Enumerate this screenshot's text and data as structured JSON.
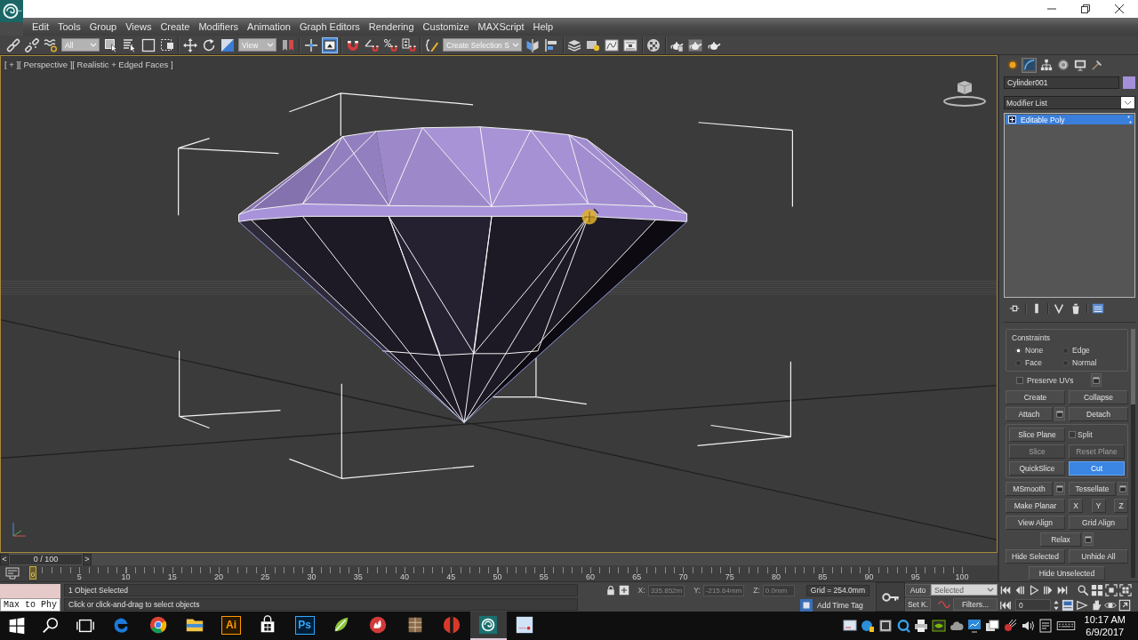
{
  "menu": [
    "Edit",
    "Tools",
    "Group",
    "Views",
    "Create",
    "Modifiers",
    "Animation",
    "Graph Editors",
    "Rendering",
    "Customize",
    "MAXScript",
    "Help"
  ],
  "toolbar": {
    "groups": [
      [
        {
          "kind": "link",
          "active": false
        },
        {
          "kind": "unlink",
          "active": false
        },
        {
          "kind": "bind",
          "active": false
        },
        {
          "kind": "dropdown",
          "value": "All",
          "active": false
        },
        {
          "kind": "select",
          "active": false
        },
        {
          "kind": "select-by-name",
          "active": false
        },
        {
          "kind": "region",
          "active": false
        },
        {
          "kind": "window-crossing",
          "active": false
        }
      ],
      [
        {
          "kind": "move",
          "active": false
        },
        {
          "kind": "rotate",
          "active": false
        },
        {
          "kind": "scale",
          "active": false
        },
        {
          "kind": "dropdown",
          "value": "View",
          "active": false
        },
        {
          "kind": "pivot",
          "active": false
        }
      ],
      [
        {
          "kind": "manipulate",
          "active": false
        },
        {
          "kind": "override",
          "active": true
        }
      ],
      [
        {
          "kind": "snap",
          "active": false
        },
        {
          "kind": "angle-snap",
          "active": false
        },
        {
          "kind": "percent-snap",
          "active": false
        },
        {
          "kind": "spinner-snap",
          "active": false
        }
      ],
      [
        {
          "kind": "named-selection",
          "active": false
        },
        {
          "kind": "dropdown",
          "value": "Create Selection S",
          "active": false
        },
        {
          "kind": "mirror",
          "active": false
        },
        {
          "kind": "align",
          "active": false
        }
      ],
      [
        {
          "kind": "layers",
          "active": false
        },
        {
          "kind": "scene-explorer",
          "active": false
        },
        {
          "kind": "curve-editor",
          "active": false
        },
        {
          "kind": "schematic",
          "active": false
        }
      ],
      [
        {
          "kind": "material-editor",
          "active": false
        }
      ],
      [
        {
          "kind": "render-setup",
          "active": false
        },
        {
          "kind": "rendered-frame",
          "active": false
        },
        {
          "kind": "render",
          "active": false
        }
      ]
    ]
  },
  "viewport": {
    "labels": [
      "[ + ]",
      "[ Perspective ]",
      "[ Realistic + Edged Faces ]"
    ]
  },
  "time_slider": {
    "previous": "<",
    "position": "0 / 100",
    "next": ">",
    "level": 0
  },
  "track_bar": {
    "current_frame": "0",
    "labels": [
      "5",
      "10",
      "15",
      "20",
      "25",
      "30",
      "35",
      "40",
      "45",
      "50",
      "55",
      "60",
      "65",
      "70",
      "75",
      "80",
      "85",
      "90",
      "95",
      "100"
    ]
  },
  "command_panel": {
    "tabs": [
      {
        "kind": "create",
        "selected": false
      },
      {
        "kind": "modify",
        "selected": true
      },
      {
        "kind": "hierarchy",
        "selected": false
      },
      {
        "kind": "motion",
        "selected": false
      },
      {
        "kind": "display",
        "selected": false
      },
      {
        "kind": "utilities",
        "selected": false
      }
    ],
    "object_name": "Cylinder001",
    "modifier_list": "Modifier List",
    "stack": [
      {
        "label": "Editable Poly",
        "selected": true,
        "expanded": false
      }
    ],
    "constraints": {
      "title": "Constraints",
      "options": [
        {
          "label": "None",
          "selected": true
        },
        {
          "label": "Edge",
          "selected": false
        },
        {
          "label": "Face",
          "selected": false
        },
        {
          "label": "Normal",
          "selected": false
        }
      ]
    },
    "preserve_uvs": {
      "label": "Preserve UVs",
      "checked": false
    },
    "rows": [
      {
        "kind": "split",
        "items": [
          {
            "kind": "button",
            "label": "Create",
            "disabled": false,
            "active": false
          },
          {
            "kind": "button",
            "label": "Collapse",
            "disabled": false,
            "active": false
          }
        ]
      },
      {
        "kind": "split",
        "items": [
          {
            "kind": "button",
            "label": "Attach",
            "disabled": false,
            "active": false
          },
          {
            "kind": "settings"
          },
          {
            "kind": "button",
            "label": "Detach",
            "disabled": false,
            "active": false
          }
        ]
      },
      {
        "kind": "group",
        "rows": [
          {
            "kind": "split",
            "items": [
              {
                "kind": "button",
                "label": "Slice Plane",
                "disabled": false,
                "active": false
              },
              {
                "kind": "checkbox",
                "label": "Split",
                "checked": false
              }
            ]
          },
          {
            "kind": "split",
            "items": [
              {
                "kind": "button",
                "label": "Slice",
                "disabled": true,
                "active": false
              },
              {
                "kind": "button",
                "label": "Reset Plane",
                "disabled": true,
                "active": false
              }
            ]
          },
          {
            "kind": "split",
            "items": [
              {
                "kind": "button",
                "label": "QuickSlice",
                "disabled": false,
                "active": false
              },
              {
                "kind": "button",
                "label": "Cut",
                "disabled": false,
                "active": true
              }
            ]
          }
        ]
      },
      {
        "kind": "split",
        "items": [
          {
            "kind": "button",
            "label": "MSmooth",
            "disabled": false,
            "active": false
          },
          {
            "kind": "settings"
          },
          {
            "kind": "button",
            "label": "Tessellate",
            "disabled": false,
            "active": false
          },
          {
            "kind": "settings"
          }
        ]
      },
      {
        "kind": "split",
        "items": [
          {
            "kind": "button",
            "label": "Make Planar",
            "disabled": false,
            "active": false
          },
          {
            "kind": "axis",
            "label": "X",
            "disabled": false,
            "active": false
          },
          {
            "kind": "axis",
            "label": "Y",
            "disabled": false,
            "active": false
          },
          {
            "kind": "axis",
            "label": "Z",
            "disabled": false,
            "active": false
          }
        ]
      },
      {
        "kind": "split",
        "items": [
          {
            "kind": "button",
            "label": "View Align",
            "disabled": false,
            "active": false
          },
          {
            "kind": "button",
            "label": "Grid Align",
            "disabled": false,
            "active": false
          }
        ]
      },
      {
        "kind": "center",
        "items": [
          {
            "kind": "button",
            "label": "Relax",
            "disabled": false,
            "active": false
          },
          {
            "kind": "settings"
          }
        ]
      },
      {
        "kind": "split",
        "items": [
          {
            "kind": "button",
            "label": "Hide Selected",
            "disabled": false,
            "active": false
          },
          {
            "kind": "button",
            "label": "Unhide All",
            "disabled": false,
            "active": false
          }
        ]
      },
      {
        "kind": "center",
        "items": [
          {
            "kind": "button",
            "label": "Hide Unselected",
            "disabled": false,
            "active": false
          }
        ]
      }
    ]
  },
  "status": {
    "listener": "Max to Phy",
    "selection": "1 Object Selected",
    "prompt": "Click or click-and-drag to select objects",
    "coords": [
      {
        "axis": "X:",
        "value": "335.852m",
        "disabled": true
      },
      {
        "axis": "Y:",
        "value": "-215.64mm",
        "disabled": true
      },
      {
        "axis": "Z:",
        "value": "0.0mm",
        "disabled": true
      }
    ],
    "grid": "Grid = 254.0mm",
    "time_tag": "Add Time Tag"
  },
  "animation_controls": {
    "auto_key": "Auto",
    "set_key": "Set K.",
    "key_filter": "Selected",
    "filters": "Filters...",
    "frame": "0"
  },
  "taskbar": {
    "apps": [
      {
        "kind": "swirl",
        "active": false
      },
      {
        "kind": "ring",
        "active": false
      },
      {
        "kind": "folder",
        "active": false
      },
      {
        "kind": "tile-warm",
        "label": "Ai",
        "active": false
      },
      {
        "kind": "bag",
        "active": false
      },
      {
        "kind": "tile-cool",
        "label": "Ps",
        "active": false
      },
      {
        "kind": "leaf",
        "active": false
      },
      {
        "kind": "flame",
        "active": false
      },
      {
        "kind": "crate",
        "active": false
      },
      {
        "kind": "ball",
        "active": false
      },
      {
        "kind": "spiral",
        "active": true
      },
      {
        "kind": "card",
        "active": false
      }
    ],
    "clock": {
      "time": "10:17 AM",
      "date": "6/9/2017"
    }
  }
}
